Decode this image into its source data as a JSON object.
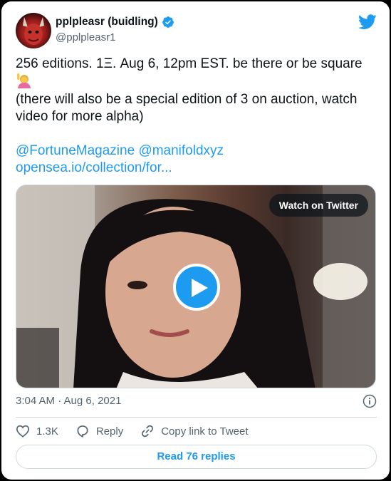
{
  "author": {
    "display_name": "pplpleasr (buidling)",
    "handle": "@pplpleasr1",
    "verified_icon": "verified-badge-icon"
  },
  "tweet": {
    "line1": "256 editions. 1Ξ. Aug 6, 12pm EST. be there or be square",
    "line2": "(there will also be a special edition of 3 on auction, watch",
    "line3": "video for more alpha)",
    "mention1": "@FortuneMagazine",
    "mention2": "@manifoldxyz",
    "url": "opensea.io/collection/for..."
  },
  "media": {
    "watch_label": "Watch on Twitter",
    "play_icon": "play-icon"
  },
  "meta": {
    "timestamp": "3:04 AM · Aug 6, 2021"
  },
  "actions": {
    "likes": "1.3K",
    "reply_label": "Reply",
    "copy_label": "Copy link to Tweet"
  },
  "read_replies": "Read 76 replies",
  "colors": {
    "accent": "#1d9bf0",
    "text": "#0f1419",
    "muted": "#536471",
    "border": "#cfd9de"
  }
}
